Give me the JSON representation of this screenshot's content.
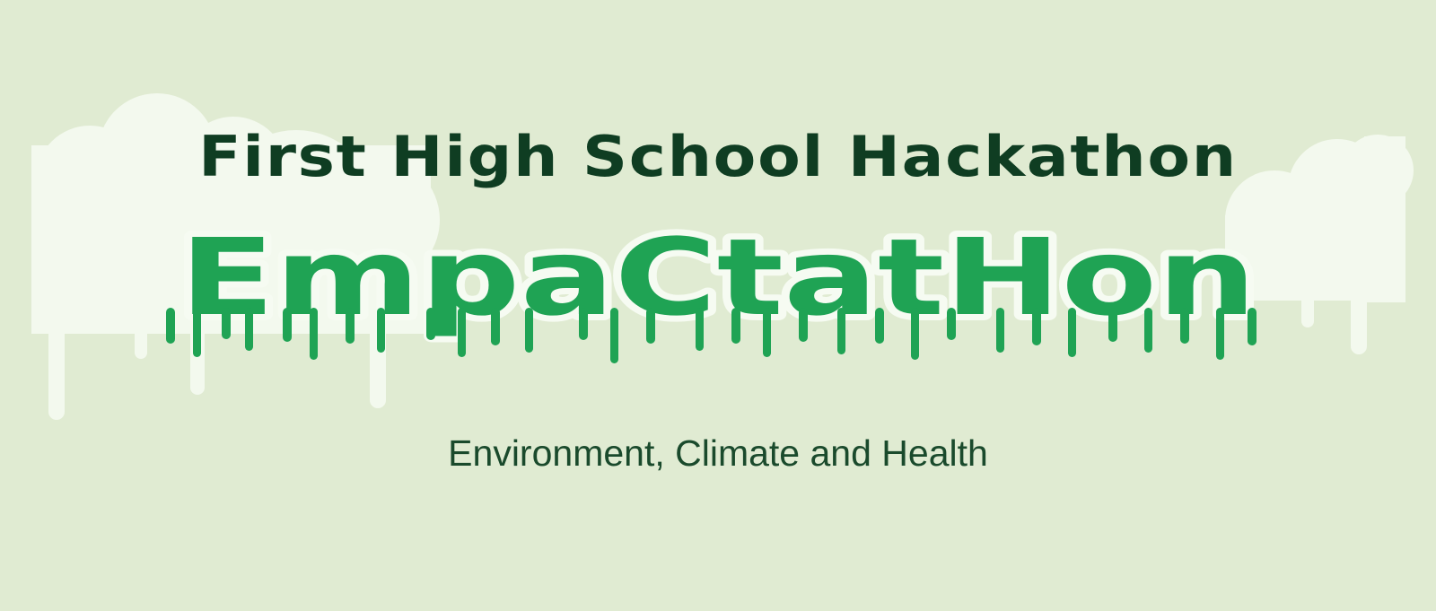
{
  "banner": {
    "headline": "First High School Hackathon",
    "logo_text": "EmpaCtatHon",
    "subtitle": "Environment, Climate and Health"
  },
  "colors": {
    "background": "#e0ebd2",
    "headline": "#0f3d22",
    "logo_fill": "#1fa354",
    "logo_outline": "#f6fbf2",
    "cloud": "#f3f9ee",
    "subtitle": "#1a4a2c"
  }
}
